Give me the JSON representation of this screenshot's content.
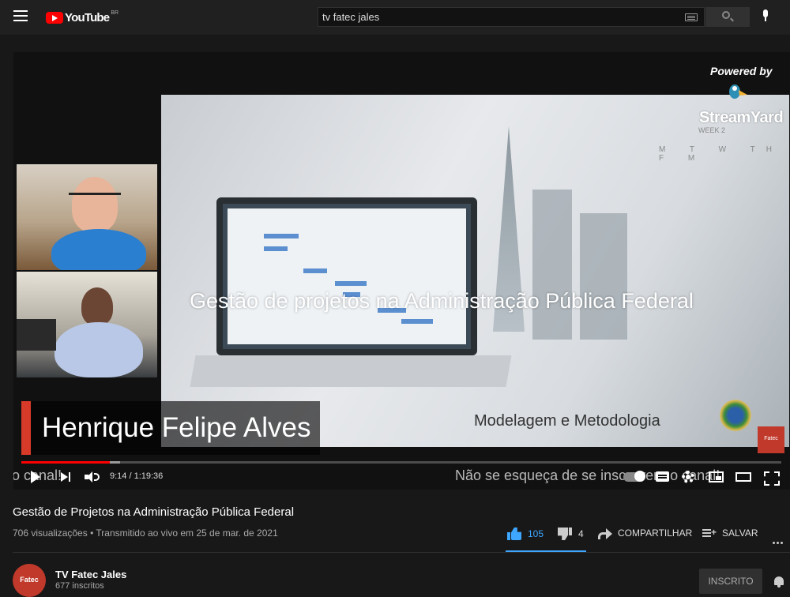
{
  "header": {
    "logo_text": "YouTube",
    "country": "BR",
    "search_value": "tv fatec jales"
  },
  "player": {
    "powered_by": "Powered by",
    "streamyard": "StreamYard",
    "slide_title": "Gestão de projetos na Administração Pública Federal",
    "slide_subtitle": "Modelagem e Metodologia",
    "slide_week": "WEEK 2",
    "slide_calendar": "M T W TH F M",
    "fatec_badge": "Fatec",
    "lower_third_name": "Henrique Felipe Alves",
    "time": "9:14 / 1:19:36",
    "ticker_left": "o canal!",
    "ticker_right": "Não se esqueça de se inscrever no canal!",
    "progress_fraction": 0.116,
    "buffer_fraction": 0.13,
    "accent_color": "#ff0000"
  },
  "video": {
    "title": "Gestão de Projetos na Administração Pública Federal",
    "views": "706 visualizações",
    "separator": "•",
    "streamed": "Transmitido ao vivo em 25 de mar. de 2021",
    "likes": "105",
    "dislikes": "4",
    "share_label": "COMPARTILHAR",
    "save_label": "SALVAR"
  },
  "channel": {
    "avatar_text": "Fatec",
    "name": "TV Fatec Jales",
    "subscribers": "677 inscritos",
    "subscribed_label": "INSCRITO"
  }
}
